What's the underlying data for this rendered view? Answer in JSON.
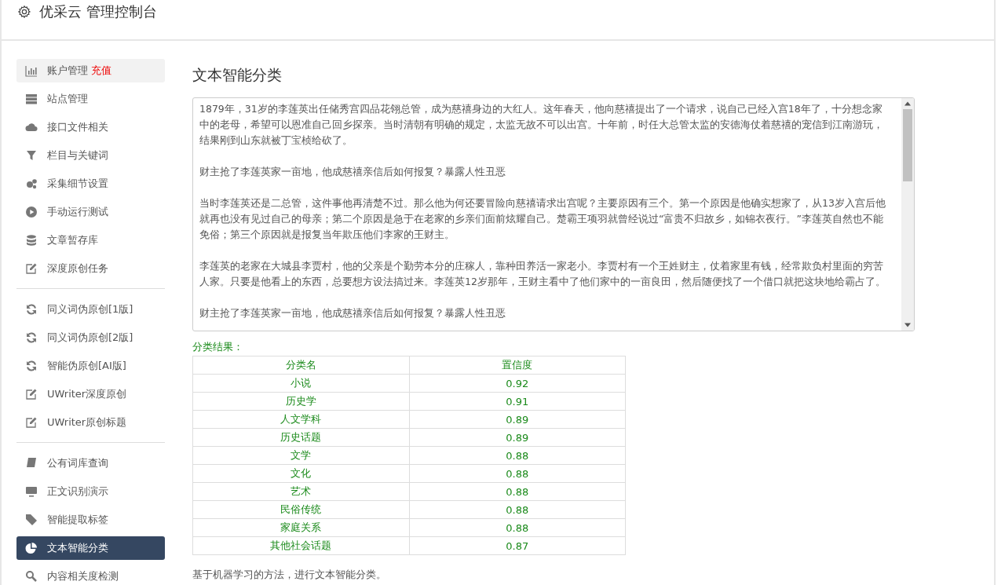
{
  "header": {
    "title": "优采云 管理控制台"
  },
  "sidebar": {
    "groups": [
      [
        {
          "label": "账户管理",
          "badge": "充值",
          "selected": false,
          "hovered": true
        },
        {
          "label": "站点管理",
          "selected": false,
          "hovered": false
        },
        {
          "label": "接口文件相关",
          "selected": false,
          "hovered": false
        },
        {
          "label": "栏目与关键词",
          "selected": false,
          "hovered": false
        },
        {
          "label": "采集细节设置",
          "selected": false,
          "hovered": false
        },
        {
          "label": "手动运行测试",
          "selected": false,
          "hovered": false
        },
        {
          "label": "文章暂存库",
          "selected": false,
          "hovered": false
        },
        {
          "label": "深度原创任务",
          "selected": false,
          "hovered": false
        }
      ],
      [
        {
          "label": "同义词伪原创[1版]",
          "selected": false,
          "hovered": false
        },
        {
          "label": "同义词伪原创[2版]",
          "selected": false,
          "hovered": false
        },
        {
          "label": "智能伪原创[AI版]",
          "selected": false,
          "hovered": false
        },
        {
          "label": "UWriter深度原创",
          "selected": false,
          "hovered": false
        },
        {
          "label": "UWriter原创标题",
          "selected": false,
          "hovered": false
        }
      ],
      [
        {
          "label": "公有词库查询",
          "selected": false,
          "hovered": false
        },
        {
          "label": "正文识别演示",
          "selected": false,
          "hovered": false
        },
        {
          "label": "智能提取标签",
          "selected": false,
          "hovered": false
        },
        {
          "label": "文本智能分类",
          "selected": true,
          "hovered": false
        },
        {
          "label": "内容相关度检测",
          "selected": false,
          "hovered": false
        }
      ]
    ]
  },
  "main": {
    "title": "文本智能分类",
    "text_area": {
      "paragraphs": [
        "1879年，31岁的李莲英出任储秀宫四品花翎总管，成为慈禧身边的大红人。这年春天，他向慈禧提出了一个请求，说自己已经入宫18年了，十分想念家中的老母，希望可以恩准自己回乡探亲。当时清朝有明确的规定，太监无故不可以出宫。十年前，时任大总管太监的安德海仗着慈禧的宠信到江南游玩，结果刚到山东就被丁宝桢给砍了。",
        "财主抢了李莲英家一亩地，他成慈禧亲信后如何报复？暴露人性丑恶",
        "当时李莲英还是二总管，这件事他再清楚不过。那么他为何还要冒险向慈禧请求出宫呢？主要原因有三个。第一个原因是他确实想家了，从13岁入宫后他就再也没有见过自己的母亲；第二个原因是急于在老家的乡亲们面前炫耀自己。楚霸王项羽就曾经说过“富贵不归故乡，如锦衣夜行。”李莲英自然也不能免俗；第三个原因就是报复当年欺压他们李家的王财主。",
        "李莲英的老家在大城县李贾村，他的父亲是个勤劳本分的庄稼人，靠种田养活一家老小。李贾村有一个王姓财主，仗着家里有钱，经常欺负村里面的穷苦人家。只要是他看上的东西，总要想方设法搞过来。李莲英12岁那年，王财主看中了他们家中的一亩良田，然后随便找了一个借口就把这块地给霸占了。",
        "财主抢了李莲英家一亩地，他成慈禧亲信后如何报复？暴露人性丑恶"
      ]
    },
    "result_label": "分类结果：",
    "table": {
      "columns": [
        "分类名",
        "置信度"
      ],
      "rows": [
        [
          "小说",
          "0.92"
        ],
        [
          "历史学",
          "0.91"
        ],
        [
          "人文学科",
          "0.89"
        ],
        [
          "历史话题",
          "0.89"
        ],
        [
          "文学",
          "0.88"
        ],
        [
          "文化",
          "0.88"
        ],
        [
          "艺术",
          "0.88"
        ],
        [
          "民俗传统",
          "0.88"
        ],
        [
          "家庭关系",
          "0.88"
        ],
        [
          "其他社会话题",
          "0.87"
        ]
      ]
    },
    "note": "基于机器学习的方法，进行文本智能分类。"
  }
}
